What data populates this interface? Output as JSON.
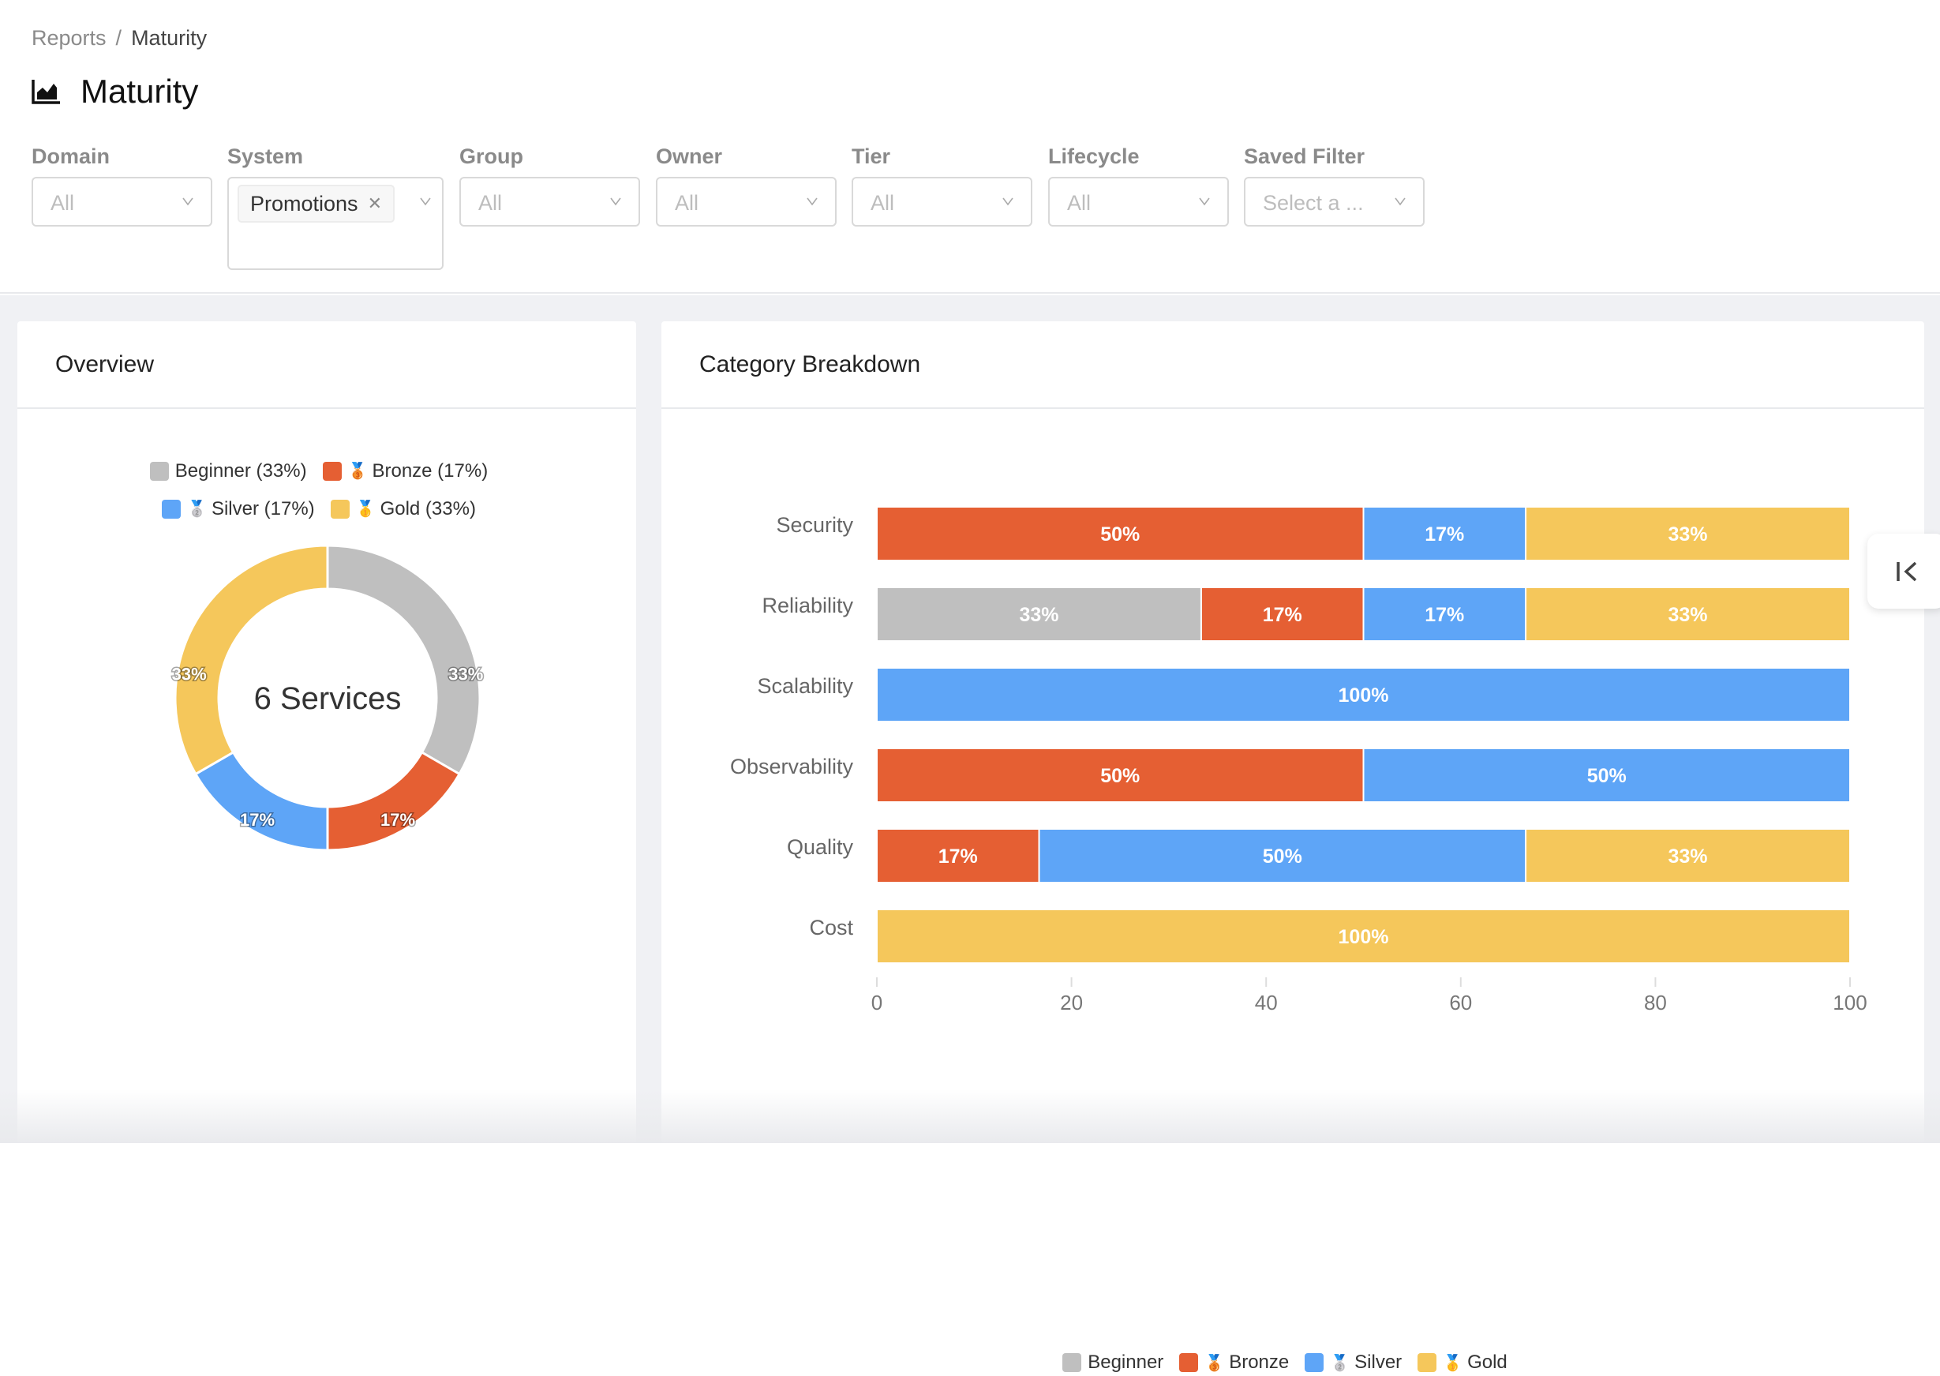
{
  "breadcrumb": {
    "parent": "Reports",
    "separator": "/",
    "current": "Maturity"
  },
  "page": {
    "title": "Maturity",
    "icon": "area-chart-icon"
  },
  "filters": [
    {
      "label": "Domain",
      "value": "All"
    },
    {
      "label": "System",
      "tags": [
        "Promotions"
      ]
    },
    {
      "label": "Group",
      "value": "All"
    },
    {
      "label": "Owner",
      "value": "All"
    },
    {
      "label": "Tier",
      "value": "All"
    },
    {
      "label": "Lifecycle",
      "value": "All"
    },
    {
      "label": "Saved Filter",
      "placeholder": "Select a ..."
    }
  ],
  "colors": {
    "Beginner": "#bfbfbf",
    "Bronze": "#e55f33",
    "Silver": "#5ea5f7",
    "Gold": "#f5c75b"
  },
  "overview": {
    "title": "Overview",
    "center_label": "6 Services",
    "legend": [
      {
        "name": "Beginner",
        "medal": "",
        "label": "Beginner (33%)"
      },
      {
        "name": "Bronze",
        "medal": "🥉",
        "label": "Bronze (17%)"
      },
      {
        "name": "Silver",
        "medal": "🥈",
        "label": "Silver (17%)"
      },
      {
        "name": "Gold",
        "medal": "🥇",
        "label": "Gold (33%)"
      }
    ]
  },
  "breakdown": {
    "title": "Category Breakdown",
    "legend": [
      {
        "name": "Beginner",
        "medal": "",
        "label": "Beginner"
      },
      {
        "name": "Bronze",
        "medal": "🥉",
        "label": "Bronze"
      },
      {
        "name": "Silver",
        "medal": "🥈",
        "label": "Silver"
      },
      {
        "name": "Gold",
        "medal": "🥇",
        "label": "Gold"
      }
    ]
  },
  "chart_data": [
    {
      "type": "pie",
      "title": "Overview",
      "donut": true,
      "center_label": "6 Services",
      "categories": [
        "Beginner",
        "Bronze",
        "Silver",
        "Gold"
      ],
      "values": [
        2,
        1,
        1,
        2
      ],
      "percent_labels": [
        "33%",
        "17%",
        "17%",
        "33%"
      ],
      "legend": "top"
    },
    {
      "type": "bar",
      "orientation": "horizontal",
      "stacked": true,
      "title": "Category Breakdown",
      "categories": [
        "Security",
        "Reliability",
        "Scalability",
        "Observability",
        "Quality",
        "Cost"
      ],
      "series": [
        {
          "name": "Beginner",
          "values": [
            0,
            33.33,
            0,
            0,
            0,
            0
          ]
        },
        {
          "name": "Bronze",
          "values": [
            50,
            16.67,
            0,
            50,
            16.67,
            0
          ]
        },
        {
          "name": "Silver",
          "values": [
            16.67,
            16.67,
            100,
            50,
            50,
            0
          ]
        },
        {
          "name": "Gold",
          "values": [
            33.33,
            33.33,
            0,
            0,
            33.33,
            100
          ]
        }
      ],
      "xlim": [
        0,
        100
      ],
      "xticks": [
        0,
        20,
        40,
        60,
        80,
        100
      ],
      "xlabel": "",
      "ylabel": "",
      "grid": false,
      "legend": "bottom"
    }
  ],
  "collapse_button": {
    "icon": "collapse-left-icon"
  }
}
